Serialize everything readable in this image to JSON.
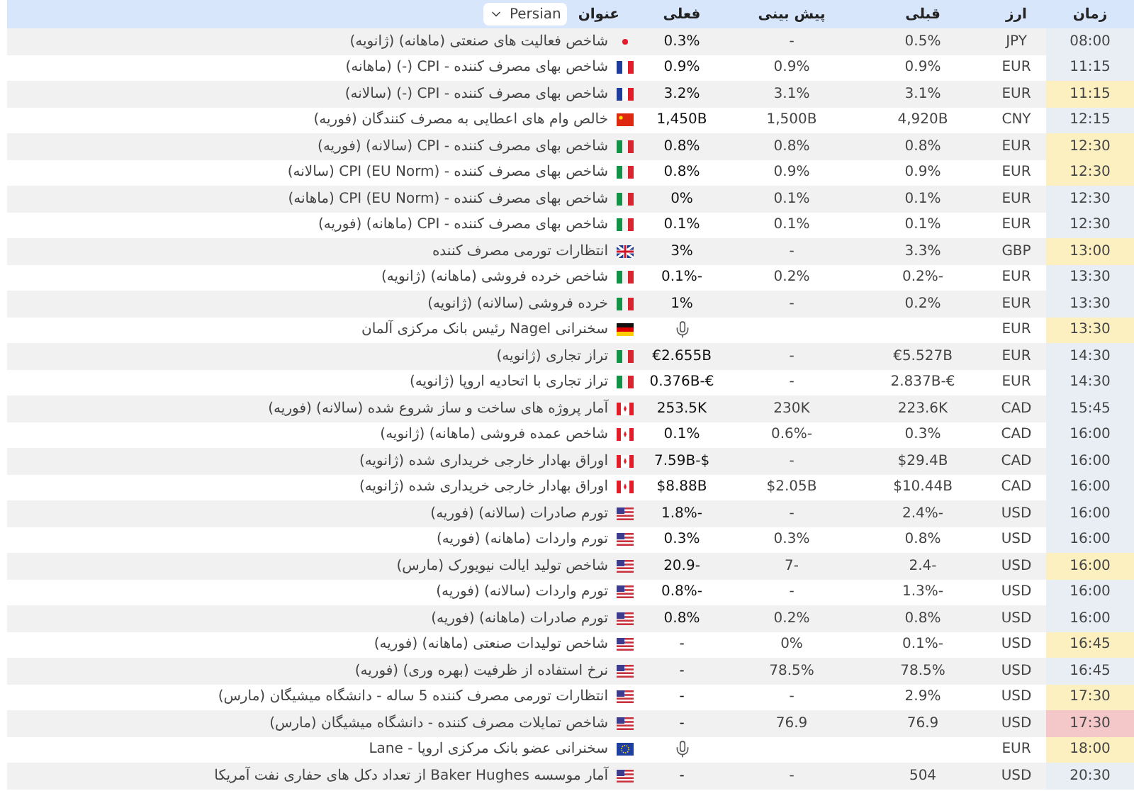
{
  "header": {
    "time": "زمان",
    "currency": "ارز",
    "previous": "قبلی",
    "forecast": "پیش بینی",
    "actual": "فعلی",
    "title": "عنوان",
    "language": "Persian"
  },
  "rows": [
    {
      "time": "08:00",
      "currency": "JPY",
      "flag": {
        "kind": "jp"
      },
      "title": "شاخص فعالیت های صنعتی (ماهانه) (ژانویه)",
      "actual": "0.3%",
      "forecast": "-",
      "previous": "0.5%"
    },
    {
      "time": "11:15",
      "currency": "EUR",
      "flag": {
        "kind": "fr"
      },
      "title": "شاخص بهای مصرف کننده - CPI (-) (ماهانه)",
      "actual": "0.9%",
      "forecast": "0.9%",
      "previous": "0.9%"
    },
    {
      "time": "11:15",
      "currency": "EUR",
      "flag": {
        "kind": "fr"
      },
      "title": "شاخص بهای مصرف کننده - CPI (-) (سالانه)",
      "actual": "3.2%",
      "forecast": "3.1%",
      "previous": "3.1%",
      "color": "#fcefc0"
    },
    {
      "time": "12:15",
      "currency": "CNY",
      "flag": {
        "kind": "cn"
      },
      "title": "خالص وام های اعطایی به مصرف کنندگان (فوریه)",
      "actual": "1,450B",
      "forecast": "1,500B",
      "previous": "4,920B"
    },
    {
      "time": "12:30",
      "currency": "EUR",
      "flag": {
        "kind": "it"
      },
      "title": "شاخص بهای مصرف کننده - CPI (سالانه) (فوریه)",
      "actual": "0.8%",
      "forecast": "0.8%",
      "previous": "0.8%",
      "color": "#fcefc0"
    },
    {
      "time": "12:30",
      "currency": "EUR",
      "flag": {
        "kind": "it"
      },
      "title": "شاخص بهای مصرف کننده - CPI (EU Norm) (سالانه)",
      "actual": "0.8%",
      "forecast": "0.9%",
      "previous": "0.9%",
      "color": "#fcefc0"
    },
    {
      "time": "12:30",
      "currency": "EUR",
      "flag": {
        "kind": "it"
      },
      "title": "شاخص بهای مصرف کننده - CPI (EU Norm) (ماهانه)",
      "actual": "0%",
      "forecast": "0.1%",
      "previous": "0.1%"
    },
    {
      "time": "12:30",
      "currency": "EUR",
      "flag": {
        "kind": "it"
      },
      "title": "شاخص بهای مصرف کننده - CPI (ماهانه) (فوریه)",
      "actual": "0.1%",
      "forecast": "0.1%",
      "previous": "0.1%"
    },
    {
      "time": "13:00",
      "currency": "GBP",
      "flag": {
        "kind": "gb"
      },
      "title": "انتظارات تورمی مصرف کننده",
      "actual": "3%",
      "forecast": "-",
      "previous": "3.3%",
      "color": "#fcefc0"
    },
    {
      "time": "13:30",
      "currency": "EUR",
      "flag": {
        "kind": "it"
      },
      "title": "شاخص خرده فروشی (ماهانه) (ژانویه)",
      "actual": "0.1%-",
      "forecast": "0.2%",
      "previous": "0.2%-"
    },
    {
      "time": "13:30",
      "currency": "EUR",
      "flag": {
        "kind": "it"
      },
      "title": "خرده فروشی (سالانه) (ژانویه)",
      "actual": "1%",
      "forecast": "-",
      "previous": "0.2%"
    },
    {
      "time": "13:30",
      "currency": "EUR",
      "flag": {
        "kind": "de"
      },
      "kind": "speech",
      "title": "سخنرانی Nagel رئیس بانک مرکزی آلمان",
      "color": "#fcefc0"
    },
    {
      "time": "14:30",
      "currency": "EUR",
      "flag": {
        "kind": "it"
      },
      "title": "تراز تجاری (ژانویه)",
      "actual": "€2.655B",
      "forecast": "-",
      "previous": "€5.527B"
    },
    {
      "time": "14:30",
      "currency": "EUR",
      "flag": {
        "kind": "it"
      },
      "title": "تراز تجاری با اتحادیه اروپا (ژانویه)",
      "actual": "0.376B-€",
      "forecast": "-",
      "previous": "2.837B-€"
    },
    {
      "time": "15:45",
      "currency": "CAD",
      "flag": {
        "kind": "ca"
      },
      "title": "آمار پروژه های ساخت و ساز شروع شده (سالانه) (فوریه)",
      "actual": "253.5K",
      "forecast": "230K",
      "previous": "223.6K"
    },
    {
      "time": "16:00",
      "currency": "CAD",
      "flag": {
        "kind": "ca"
      },
      "title": "شاخص عمده فروشی (ماهانه) (ژانویه)",
      "actual": "0.1%",
      "forecast": "0.6%-",
      "previous": "0.3%"
    },
    {
      "time": "16:00",
      "currency": "CAD",
      "flag": {
        "kind": "ca"
      },
      "title": "اوراق بهادار خارجی خریداری شده (ژانویه)",
      "actual": "7.59B-$",
      "forecast": "-",
      "previous": "$29.4B"
    },
    {
      "time": "16:00",
      "currency": "CAD",
      "flag": {
        "kind": "ca"
      },
      "title": "اوراق بهادار خارجی خریداری شده (ژانویه)",
      "actual": "$8.88B",
      "forecast": "$2.05B",
      "previous": "$10.44B"
    },
    {
      "time": "16:00",
      "currency": "USD",
      "flag": {
        "kind": "us"
      },
      "title": "تورم صادرات (سالانه) (فوریه)",
      "actual": "1.8%-",
      "forecast": "-",
      "previous": "2.4%-"
    },
    {
      "time": "16:00",
      "currency": "USD",
      "flag": {
        "kind": "us"
      },
      "title": "تورم واردات (ماهانه) (فوریه)",
      "actual": "0.3%",
      "forecast": "0.3%",
      "previous": "0.8%"
    },
    {
      "time": "16:00",
      "currency": "USD",
      "flag": {
        "kind": "us"
      },
      "title": "شاخص تولید ایالت نیویورک (مارس)",
      "actual": "20.9-",
      "forecast": "7-",
      "previous": "2.4-",
      "color": "#fcefc0"
    },
    {
      "time": "16:00",
      "currency": "USD",
      "flag": {
        "kind": "us"
      },
      "title": "تورم واردات (سالانه) (فوریه)",
      "actual": "0.8%-",
      "forecast": "-",
      "previous": "1.3%-"
    },
    {
      "time": "16:00",
      "currency": "USD",
      "flag": {
        "kind": "us"
      },
      "title": "تورم صادرات (ماهانه) (فوریه)",
      "actual": "0.8%",
      "forecast": "0.2%",
      "previous": "0.8%"
    },
    {
      "time": "16:45",
      "currency": "USD",
      "flag": {
        "kind": "us"
      },
      "title": "شاخص تولیدات صنعتی (ماهانه) (فوریه)",
      "actual": "-",
      "forecast": "0%",
      "previous": "0.1%-",
      "color": "#fcefc0"
    },
    {
      "time": "16:45",
      "currency": "USD",
      "flag": {
        "kind": "us"
      },
      "title": "نرخ استفاده از ظرفیت (بهره وری) (فوریه)",
      "actual": "-",
      "forecast": "78.5%",
      "previous": "78.5%"
    },
    {
      "time": "17:30",
      "currency": "USD",
      "flag": {
        "kind": "us"
      },
      "title": "انتظارات تورمی مصرف کننده 5 ساله - دانشگاه میشیگان (مارس)",
      "actual": "-",
      "forecast": "-",
      "previous": "2.9%",
      "color": "#fcefc0"
    },
    {
      "time": "17:30",
      "currency": "USD",
      "flag": {
        "kind": "us"
      },
      "title": "شاخص تمایلات مصرف کننده - دانشگاه میشیگان (مارس)",
      "actual": "-",
      "forecast": "76.9",
      "previous": "76.9",
      "color": "#f4c7c9"
    },
    {
      "time": "18:00",
      "currency": "EUR",
      "flag": {
        "kind": "eu"
      },
      "kind": "speech",
      "title": "سخنرانی عضو بانک مرکزی اروپا - Lane",
      "color": "#fcefc0"
    },
    {
      "time": "20:30",
      "currency": "USD",
      "flag": {
        "kind": "us"
      },
      "title": "آمار موسسه Baker Hughes از تعداد دکل های حفاری نفت آمریکا",
      "actual": "-",
      "forecast": "-",
      "previous": "504"
    }
  ]
}
